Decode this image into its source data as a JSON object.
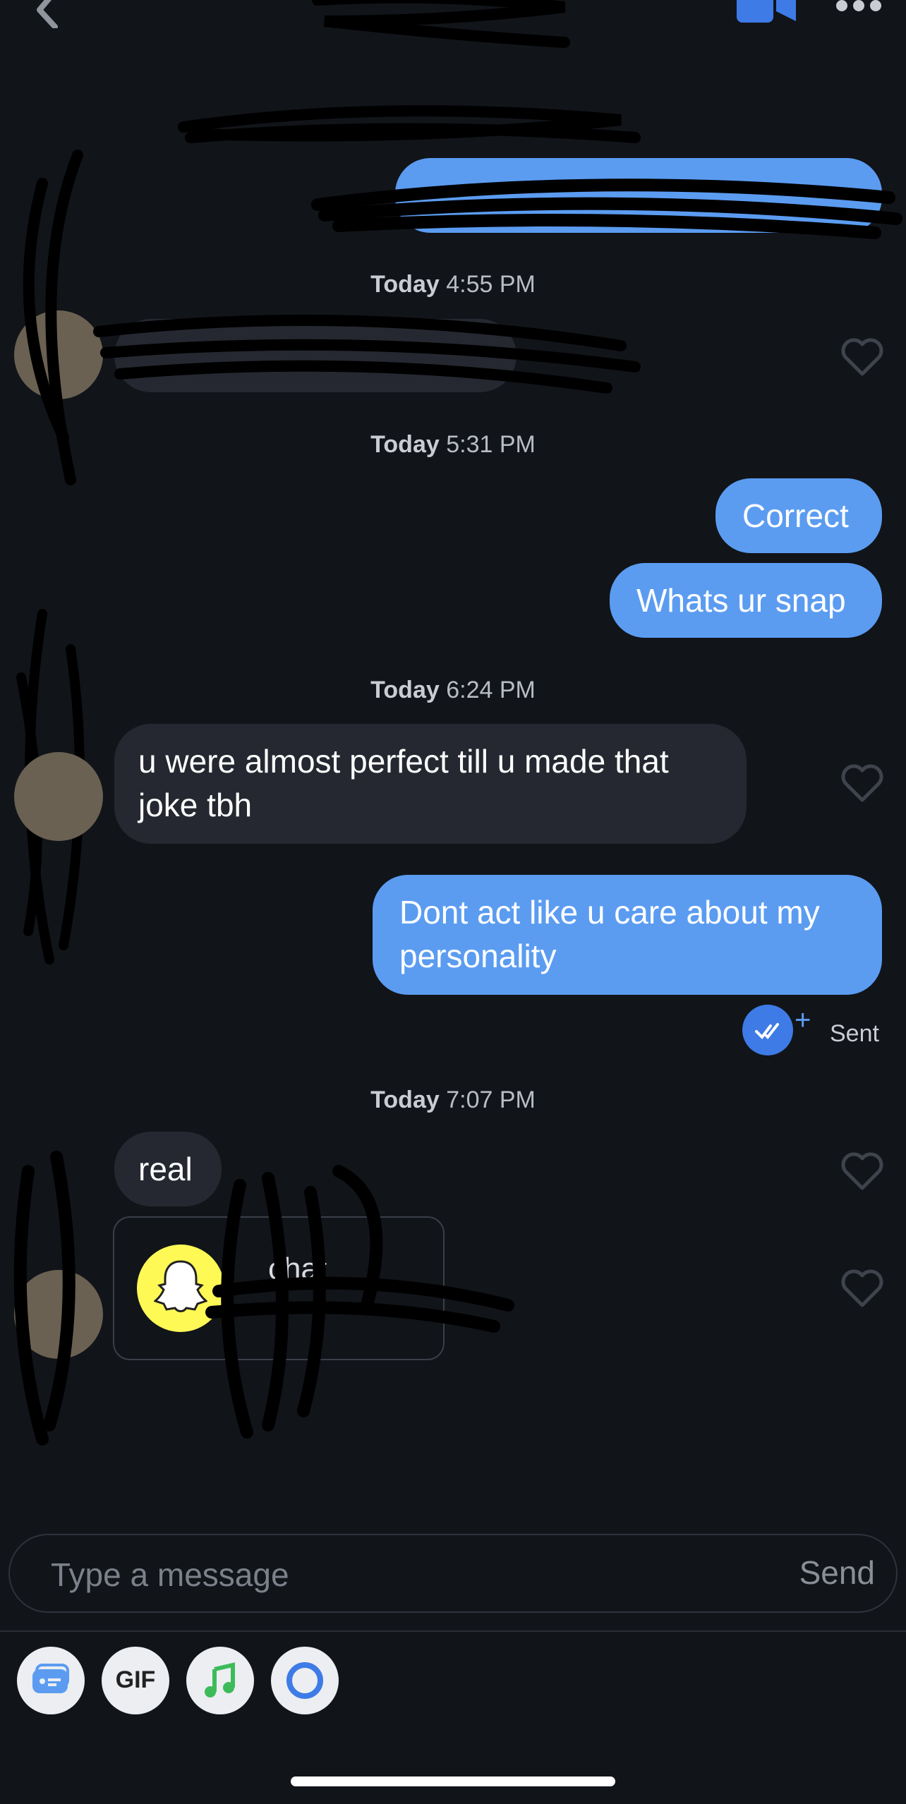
{
  "header": {
    "back_icon": "chevron-left-icon",
    "video_icon": "video-camera-icon",
    "more_icon": "more-dots-icon"
  },
  "messages": [
    {
      "kind": "timestamp",
      "day": "Today",
      "time": "4:55 PM"
    },
    {
      "kind": "timestamp",
      "day": "Today",
      "time": "5:31 PM"
    },
    {
      "kind": "sent",
      "text": "Correct"
    },
    {
      "kind": "sent",
      "text": "Whats ur snap"
    },
    {
      "kind": "timestamp",
      "day": "Today",
      "time": "6:24 PM"
    },
    {
      "kind": "received",
      "text": "u were almost perfect till u made that joke tbh"
    },
    {
      "kind": "sent",
      "text": "Dont act like u care about my personality"
    },
    {
      "kind": "status",
      "text": "Sent"
    },
    {
      "kind": "timestamp",
      "day": "Today",
      "time": "7:07 PM"
    },
    {
      "kind": "received",
      "text": "real"
    },
    {
      "kind": "received_card",
      "service": "Snapchat",
      "logo_icon": "snapchat-ghost-icon"
    }
  ],
  "snap_card": {
    "visible_text": "chat"
  },
  "composer": {
    "placeholder": "Type a message",
    "send_label": "Send"
  },
  "toolbar": [
    {
      "icon": "card-icon"
    },
    {
      "icon": "gif-icon",
      "label": "GIF"
    },
    {
      "icon": "music-icon"
    },
    {
      "icon": "circle-icon"
    }
  ],
  "colors": {
    "background": "#111419",
    "sent_bubble": "#5b9cf1",
    "received_bubble": "#252830",
    "accent": "#3e7be6",
    "snap_yellow": "#fff956"
  }
}
